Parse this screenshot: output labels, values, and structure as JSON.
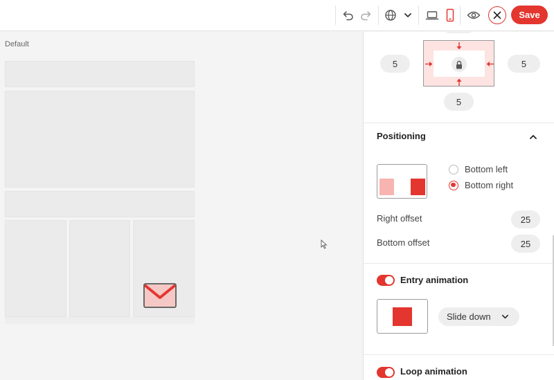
{
  "canvas": {
    "label": "Default"
  },
  "toolbar": {
    "save_label": "Save"
  },
  "spacing": {
    "left": "5",
    "right": "5",
    "bottom": "5"
  },
  "positioning": {
    "title": "Positioning",
    "options": [
      "Bottom left",
      "Bottom right"
    ],
    "selected": "Bottom right",
    "right_offset_label": "Right offset",
    "right_offset_value": "25",
    "bottom_offset_label": "Bottom offset",
    "bottom_offset_value": "25"
  },
  "entry_animation": {
    "title": "Entry animation",
    "enabled": true,
    "value": "Slide down"
  },
  "loop_animation": {
    "title": "Loop animation",
    "enabled": true
  },
  "colors": {
    "accent": "#e3362f",
    "accent_light": "#fde3e1"
  }
}
